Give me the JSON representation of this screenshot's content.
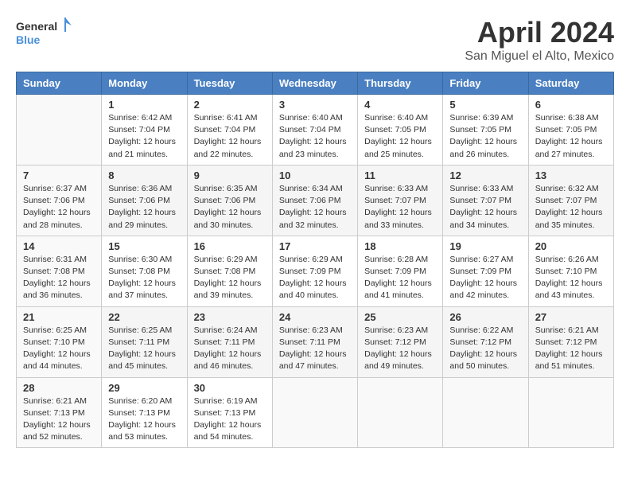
{
  "header": {
    "logo_line1": "General",
    "logo_line2": "Blue",
    "month": "April 2024",
    "location": "San Miguel el Alto, Mexico"
  },
  "days_of_week": [
    "Sunday",
    "Monday",
    "Tuesday",
    "Wednesday",
    "Thursday",
    "Friday",
    "Saturday"
  ],
  "weeks": [
    [
      {
        "day": "",
        "info": ""
      },
      {
        "day": "1",
        "info": "Sunrise: 6:42 AM\nSunset: 7:04 PM\nDaylight: 12 hours\nand 21 minutes."
      },
      {
        "day": "2",
        "info": "Sunrise: 6:41 AM\nSunset: 7:04 PM\nDaylight: 12 hours\nand 22 minutes."
      },
      {
        "day": "3",
        "info": "Sunrise: 6:40 AM\nSunset: 7:04 PM\nDaylight: 12 hours\nand 23 minutes."
      },
      {
        "day": "4",
        "info": "Sunrise: 6:40 AM\nSunset: 7:05 PM\nDaylight: 12 hours\nand 25 minutes."
      },
      {
        "day": "5",
        "info": "Sunrise: 6:39 AM\nSunset: 7:05 PM\nDaylight: 12 hours\nand 26 minutes."
      },
      {
        "day": "6",
        "info": "Sunrise: 6:38 AM\nSunset: 7:05 PM\nDaylight: 12 hours\nand 27 minutes."
      }
    ],
    [
      {
        "day": "7",
        "info": "Sunrise: 6:37 AM\nSunset: 7:06 PM\nDaylight: 12 hours\nand 28 minutes."
      },
      {
        "day": "8",
        "info": "Sunrise: 6:36 AM\nSunset: 7:06 PM\nDaylight: 12 hours\nand 29 minutes."
      },
      {
        "day": "9",
        "info": "Sunrise: 6:35 AM\nSunset: 7:06 PM\nDaylight: 12 hours\nand 30 minutes."
      },
      {
        "day": "10",
        "info": "Sunrise: 6:34 AM\nSunset: 7:06 PM\nDaylight: 12 hours\nand 32 minutes."
      },
      {
        "day": "11",
        "info": "Sunrise: 6:33 AM\nSunset: 7:07 PM\nDaylight: 12 hours\nand 33 minutes."
      },
      {
        "day": "12",
        "info": "Sunrise: 6:33 AM\nSunset: 7:07 PM\nDaylight: 12 hours\nand 34 minutes."
      },
      {
        "day": "13",
        "info": "Sunrise: 6:32 AM\nSunset: 7:07 PM\nDaylight: 12 hours\nand 35 minutes."
      }
    ],
    [
      {
        "day": "14",
        "info": "Sunrise: 6:31 AM\nSunset: 7:08 PM\nDaylight: 12 hours\nand 36 minutes."
      },
      {
        "day": "15",
        "info": "Sunrise: 6:30 AM\nSunset: 7:08 PM\nDaylight: 12 hours\nand 37 minutes."
      },
      {
        "day": "16",
        "info": "Sunrise: 6:29 AM\nSunset: 7:08 PM\nDaylight: 12 hours\nand 39 minutes."
      },
      {
        "day": "17",
        "info": "Sunrise: 6:29 AM\nSunset: 7:09 PM\nDaylight: 12 hours\nand 40 minutes."
      },
      {
        "day": "18",
        "info": "Sunrise: 6:28 AM\nSunset: 7:09 PM\nDaylight: 12 hours\nand 41 minutes."
      },
      {
        "day": "19",
        "info": "Sunrise: 6:27 AM\nSunset: 7:09 PM\nDaylight: 12 hours\nand 42 minutes."
      },
      {
        "day": "20",
        "info": "Sunrise: 6:26 AM\nSunset: 7:10 PM\nDaylight: 12 hours\nand 43 minutes."
      }
    ],
    [
      {
        "day": "21",
        "info": "Sunrise: 6:25 AM\nSunset: 7:10 PM\nDaylight: 12 hours\nand 44 minutes."
      },
      {
        "day": "22",
        "info": "Sunrise: 6:25 AM\nSunset: 7:11 PM\nDaylight: 12 hours\nand 45 minutes."
      },
      {
        "day": "23",
        "info": "Sunrise: 6:24 AM\nSunset: 7:11 PM\nDaylight: 12 hours\nand 46 minutes."
      },
      {
        "day": "24",
        "info": "Sunrise: 6:23 AM\nSunset: 7:11 PM\nDaylight: 12 hours\nand 47 minutes."
      },
      {
        "day": "25",
        "info": "Sunrise: 6:23 AM\nSunset: 7:12 PM\nDaylight: 12 hours\nand 49 minutes."
      },
      {
        "day": "26",
        "info": "Sunrise: 6:22 AM\nSunset: 7:12 PM\nDaylight: 12 hours\nand 50 minutes."
      },
      {
        "day": "27",
        "info": "Sunrise: 6:21 AM\nSunset: 7:12 PM\nDaylight: 12 hours\nand 51 minutes."
      }
    ],
    [
      {
        "day": "28",
        "info": "Sunrise: 6:21 AM\nSunset: 7:13 PM\nDaylight: 12 hours\nand 52 minutes."
      },
      {
        "day": "29",
        "info": "Sunrise: 6:20 AM\nSunset: 7:13 PM\nDaylight: 12 hours\nand 53 minutes."
      },
      {
        "day": "30",
        "info": "Sunrise: 6:19 AM\nSunset: 7:13 PM\nDaylight: 12 hours\nand 54 minutes."
      },
      {
        "day": "",
        "info": ""
      },
      {
        "day": "",
        "info": ""
      },
      {
        "day": "",
        "info": ""
      },
      {
        "day": "",
        "info": ""
      }
    ]
  ]
}
